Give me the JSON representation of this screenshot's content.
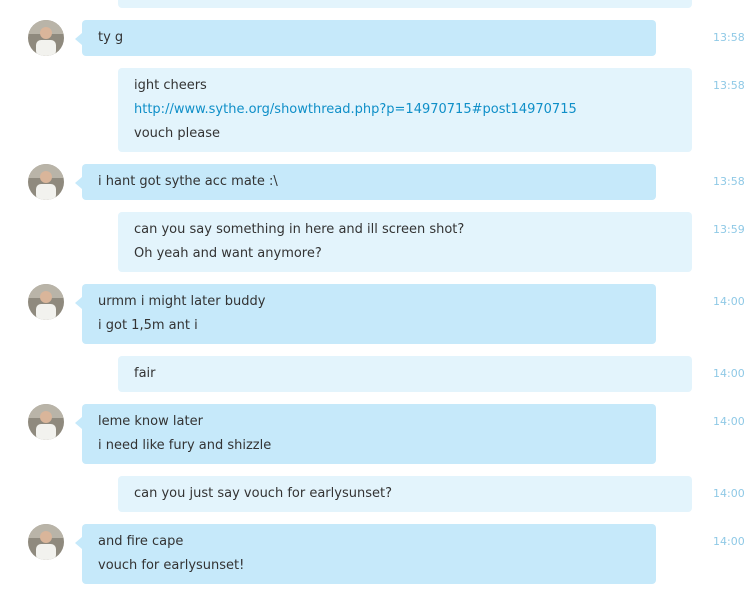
{
  "messages": [
    {
      "direction": "in",
      "time": "",
      "lines": []
    },
    {
      "direction": "in",
      "time": "13:58",
      "lines": [
        {
          "text": "ty g"
        }
      ]
    },
    {
      "direction": "out",
      "time": "13:58",
      "lines": [
        {
          "text": "ight cheers"
        },
        {
          "text": "http://www.sythe.org/showthread.php?p=14970715#post14970715",
          "link": true
        },
        {
          "text": "vouch please"
        }
      ]
    },
    {
      "direction": "in",
      "time": "13:58",
      "lines": [
        {
          "text": "i hant got sythe acc mate :\\"
        }
      ]
    },
    {
      "direction": "out",
      "time": "13:59",
      "lines": [
        {
          "text": "can you say something in here and ill screen shot?"
        },
        {
          "text": "Oh yeah and want anymore?"
        }
      ]
    },
    {
      "direction": "in",
      "time": "14:00",
      "lines": [
        {
          "text": "urmm  i might later buddy"
        },
        {
          "text": "i got 1,5m ant i"
        }
      ]
    },
    {
      "direction": "out",
      "time": "14:00",
      "lines": [
        {
          "text": "fair"
        }
      ]
    },
    {
      "direction": "in",
      "time": "14:00",
      "lines": [
        {
          "text": "leme know later"
        },
        {
          "text": "i need like fury and shizzle"
        }
      ]
    },
    {
      "direction": "out",
      "time": "14:00",
      "lines": [
        {
          "text": "can you just say vouch for earlysunset?"
        }
      ]
    },
    {
      "direction": "in",
      "time": "14:00",
      "lines": [
        {
          "text": "and fire cape"
        },
        {
          "text": "vouch for earlysunset!"
        }
      ]
    }
  ]
}
